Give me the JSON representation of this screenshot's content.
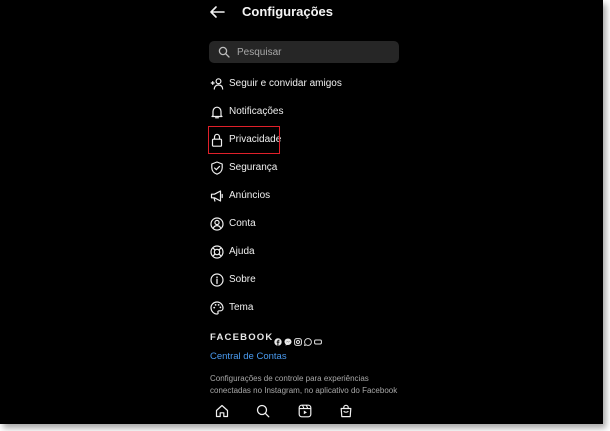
{
  "header": {
    "title": "Configurações"
  },
  "search": {
    "placeholder": "Pesquisar"
  },
  "menu": {
    "items": [
      {
        "label": "Seguir e convidar amigos"
      },
      {
        "label": "Notificações"
      },
      {
        "label": "Privacidade"
      },
      {
        "label": "Segurança"
      },
      {
        "label": "Anúncios"
      },
      {
        "label": "Conta"
      },
      {
        "label": "Ajuda"
      },
      {
        "label": "Sobre"
      },
      {
        "label": "Tema"
      }
    ]
  },
  "facebook": {
    "label": "FACEBOOK",
    "link": "Central de Contas",
    "description": "Configurações de controle para experiências conectadas no Instagram, no aplicativo do Facebook"
  },
  "colors": {
    "background": "#000000",
    "link": "#4a9bf0",
    "highlight": "#e0202a"
  }
}
